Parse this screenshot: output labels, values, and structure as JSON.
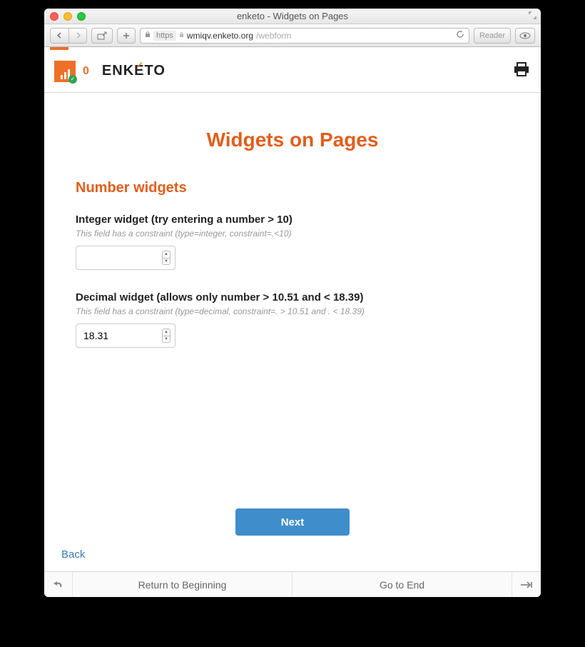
{
  "window": {
    "title": "enketo - Widgets on Pages"
  },
  "browser": {
    "scheme": "https",
    "host": "wmiqv.enketo.org",
    "path": "/webform",
    "reader_label": "Reader"
  },
  "appbar": {
    "counter": "0",
    "brand": "ENKETO"
  },
  "form": {
    "title": "Widgets on Pages",
    "section": "Number widgets",
    "fields": [
      {
        "label": "Integer widget (try entering a number > 10)",
        "hint": "This field has a constraint (type=integer, constraint=.<10)",
        "value": ""
      },
      {
        "label": "Decimal widget (allows only number > 10.51 and < 18.39)",
        "hint": "This field has a constraint (type=decimal, constraint=. > 10.51 and . < 18.39)",
        "value": "18.31"
      }
    ],
    "next_label": "Next",
    "back_label": "Back"
  },
  "footer": {
    "return_label": "Return to Beginning",
    "goto_label": "Go to End"
  }
}
